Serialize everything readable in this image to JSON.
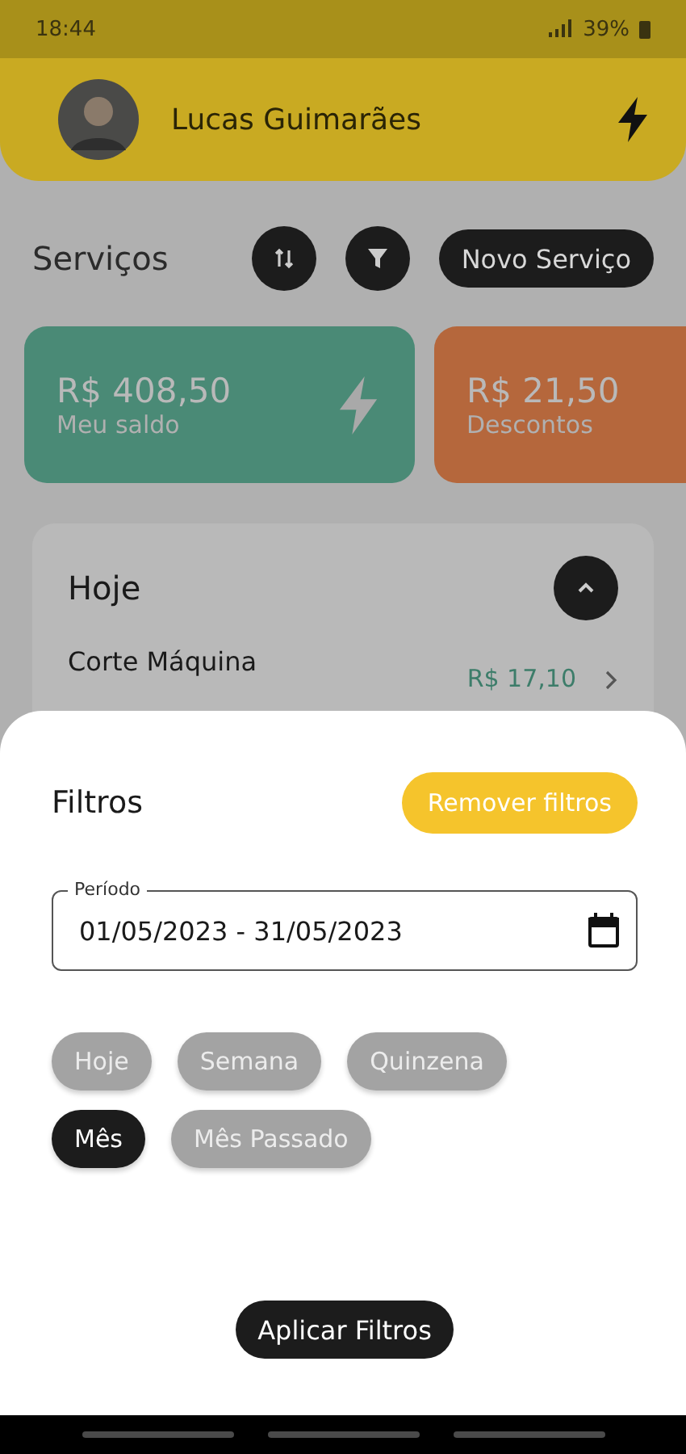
{
  "status_bar": {
    "time": "18:44",
    "battery": "39%"
  },
  "header": {
    "user_name": "Lucas Guimarães"
  },
  "services": {
    "title": "Serviços",
    "new_button": "Novo Serviço"
  },
  "cards": [
    {
      "amount": "R$ 408,50",
      "label": "Meu saldo",
      "color": "#4a8a76"
    },
    {
      "amount": "R$ 21,50",
      "label": "Descontos",
      "color": "#b5673c"
    }
  ],
  "list": {
    "group": "Hoje",
    "expanded": true,
    "items": [
      {
        "name": "Corte Máquina",
        "price": "R$ 17,10"
      }
    ]
  },
  "filters": {
    "title": "Filtros",
    "remove_button": "Remover filtros",
    "period": {
      "label": "Período",
      "value": "01/05/2023 - 31/05/2023"
    },
    "chips": [
      {
        "label": "Hoje",
        "selected": false
      },
      {
        "label": "Semana",
        "selected": false
      },
      {
        "label": "Quinzena",
        "selected": false
      },
      {
        "label": "Mês",
        "selected": true
      },
      {
        "label": "Mês Passado",
        "selected": false
      }
    ],
    "apply_button": "Aplicar Filtros"
  }
}
